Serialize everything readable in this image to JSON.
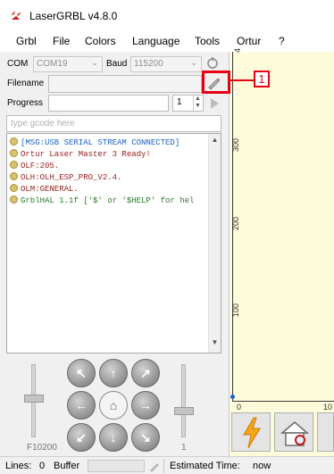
{
  "window": {
    "title": "LaserGRBL v4.8.0",
    "icon": "laser-flash-icon"
  },
  "menu": [
    "Grbl",
    "File",
    "Colors",
    "Language",
    "Tools",
    "Ortur",
    "?"
  ],
  "connection": {
    "com_label": "COM",
    "com_value": "COM19",
    "baud_label": "Baud",
    "baud_value": "115200",
    "connect_icon": "connect-plug-icon"
  },
  "file": {
    "filename_label": "Filename",
    "filename_value": "",
    "open_icon": "open-file-pencil-icon"
  },
  "progress": {
    "label": "Progress",
    "passes_value": "1",
    "run_icon": "run-arrow-icon"
  },
  "gcode_input": {
    "placeholder": "type gcode here"
  },
  "console": {
    "lines": [
      {
        "text": "[MSG:USB SERIAL STREAM CONNECTED]",
        "color": "#1b62c8"
      },
      {
        "text": "Ortur Laser Master 3 Ready!",
        "color": "#9b1c1c"
      },
      {
        "text": "OLF:205.",
        "color": "#9b1c1c"
      },
      {
        "text": "OLH:OLH_ESP_PRO_V2.4.",
        "color": "#9b1c1c"
      },
      {
        "text": "OLM:GENERAL.",
        "color": "#9b1c1c"
      },
      {
        "text": "GrblHAL 1.1f ['$' or '$HELP' for hel",
        "color": "#2b7a2b"
      }
    ]
  },
  "jog": {
    "speed_label": "F10200",
    "step_label": "1",
    "buttons": [
      "jog-up-left-icon",
      "jog-up-icon",
      "jog-up-right-icon",
      "jog-left-icon",
      "home-icon",
      "jog-right-icon",
      "jog-down-left-icon",
      "jog-down-icon",
      "jog-down-right-icon"
    ]
  },
  "canvas": {
    "y_ticks": [
      "300",
      "200",
      "100"
    ],
    "x_ticks": [
      "0",
      "10"
    ],
    "top_tick": "4"
  },
  "statusbar": {
    "lines_label": "Lines:",
    "lines_value": "0",
    "buffer_label": "Buffer",
    "estimated_label": "Estimated Time:",
    "estimated_value": "now"
  },
  "callout": {
    "number": "1"
  },
  "colors": {
    "accent_red": "#e60012",
    "canvas_bg": "#fdfbd9",
    "panel_bg": "#f0f0f0"
  }
}
